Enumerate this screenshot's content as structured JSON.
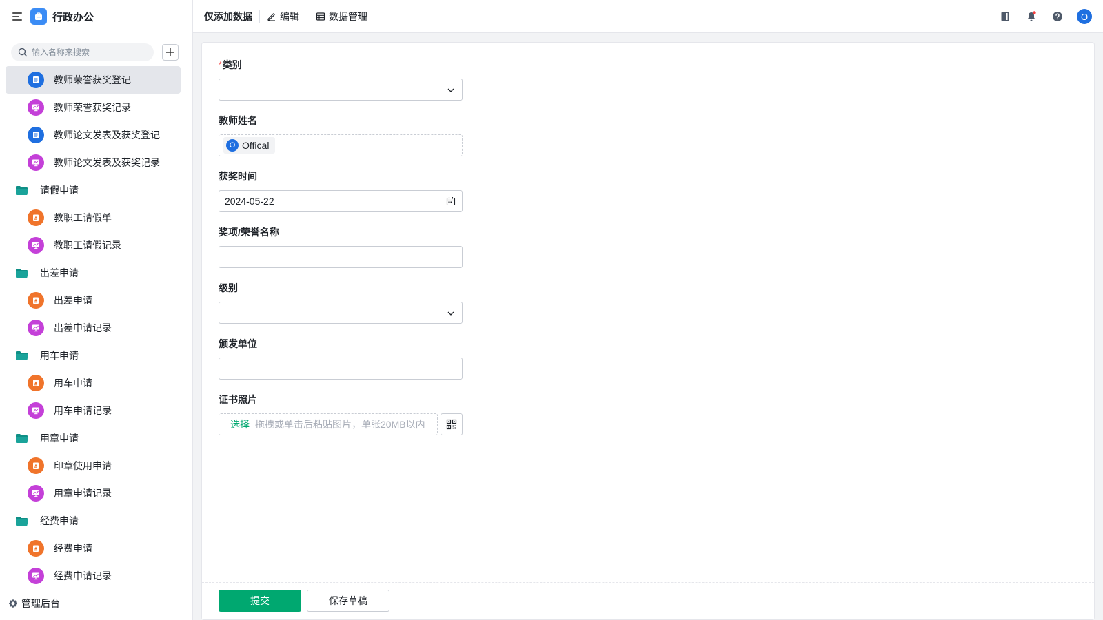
{
  "app": {
    "title": "行政办公"
  },
  "search": {
    "placeholder": "输入名称来搜索"
  },
  "sidebar": {
    "items": [
      {
        "type": "form",
        "label": "教师荣誉获奖登记",
        "active": true
      },
      {
        "type": "report",
        "label": "教师荣誉获奖记录"
      },
      {
        "type": "form",
        "label": "教师论文发表及获奖登记"
      },
      {
        "type": "report",
        "label": "教师论文发表及获奖记录"
      },
      {
        "type": "folder",
        "label": "请假申请"
      },
      {
        "type": "flow",
        "label": "教职工请假单"
      },
      {
        "type": "report",
        "label": "教职工请假记录"
      },
      {
        "type": "folder",
        "label": "出差申请"
      },
      {
        "type": "flow",
        "label": "出差申请"
      },
      {
        "type": "report",
        "label": "出差申请记录"
      },
      {
        "type": "folder",
        "label": "用车申请"
      },
      {
        "type": "flow",
        "label": "用车申请"
      },
      {
        "type": "report",
        "label": "用车申请记录"
      },
      {
        "type": "folder",
        "label": "用章申请"
      },
      {
        "type": "flow",
        "label": "印章使用申请"
      },
      {
        "type": "report",
        "label": "用章申请记录"
      },
      {
        "type": "folder",
        "label": "经费申请"
      },
      {
        "type": "flow",
        "label": "经费申请"
      },
      {
        "type": "report",
        "label": "经费申请记录"
      }
    ],
    "footer_label": "管理后台"
  },
  "topbar": {
    "title": "仅添加数据",
    "edit_label": "编辑",
    "data_manage_label": "数据管理",
    "avatar_letter": "O"
  },
  "form": {
    "category": {
      "label": "类别",
      "required_mark": "*",
      "value": ""
    },
    "teacher_name": {
      "label": "教师姓名",
      "member_initial": "O",
      "member_name": "Offical"
    },
    "award_date": {
      "label": "获奖时间",
      "value": "2024-05-22"
    },
    "award_name": {
      "label": "奖项/荣誉名称",
      "value": ""
    },
    "level": {
      "label": "级别",
      "value": ""
    },
    "issuer": {
      "label": "颁发单位",
      "value": ""
    },
    "certificate": {
      "label": "证书照片",
      "select_label": "选择",
      "hint": "拖拽或单击后粘贴图片，单张20MB以内"
    },
    "submit_label": "提交",
    "draft_label": "保存草稿"
  },
  "colors": {
    "accent": "#00a870",
    "form_badge": "#1f6fe0",
    "report_badge": "#c440d8",
    "flow_badge": "#f0742b",
    "folder": "#1aa39a",
    "required": "#f53f3f"
  }
}
